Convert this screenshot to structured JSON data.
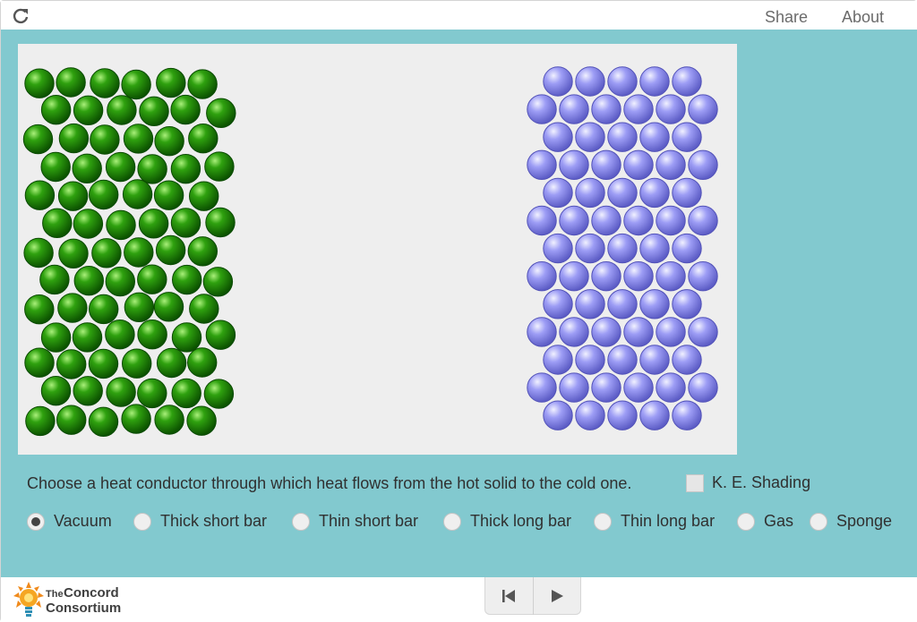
{
  "header": {
    "reload_icon": "reload-icon",
    "share_label": "Share",
    "about_label": "About"
  },
  "simulation": {
    "hot_solid_color": "#1e8a00",
    "cold_solid_color": "#8e8ef0"
  },
  "controls": {
    "prompt": "Choose a heat conductor through which heat flows from the hot solid to the cold one.",
    "ke_shading_label": "K. E. Shading",
    "ke_shading_checked": false,
    "options": [
      {
        "label": "Vacuum",
        "selected": true
      },
      {
        "label": "Thick short bar",
        "selected": false
      },
      {
        "label": "Thin short bar",
        "selected": false
      },
      {
        "label": "Thick long bar",
        "selected": false
      },
      {
        "label": "Thin long bar",
        "selected": false
      },
      {
        "label": "Gas",
        "selected": false
      },
      {
        "label": "Sponge",
        "selected": false
      }
    ]
  },
  "footer": {
    "logo_the": "The",
    "logo_concord": "Concord",
    "logo_consortium": "Consortium",
    "reset_icon": "skip-back-icon",
    "play_icon": "play-icon"
  }
}
